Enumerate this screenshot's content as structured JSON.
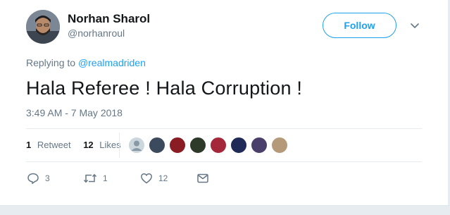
{
  "author": {
    "name": "Norhan Sharol",
    "handle": "@norhanroul"
  },
  "follow_label": "Follow",
  "reply_context": {
    "prefix": "Replying to",
    "mention": "@realmadriden"
  },
  "tweet_text": "Hala Referee ! Hala Corruption !",
  "timestamp": "3:49 AM - 7 May 2018",
  "stats": {
    "retweets_count": "1",
    "retweets_label": "Retweet",
    "likes_count": "12",
    "likes_label": "Likes"
  },
  "liker_avatars": [
    {
      "icon": "default-avatar",
      "color": "#aab8c2"
    },
    {
      "icon": "user-avatar",
      "color": "#3b4a5c"
    },
    {
      "icon": "user-avatar",
      "color": "#8a1c24"
    },
    {
      "icon": "user-avatar",
      "color": "#2d3a2a"
    },
    {
      "icon": "user-avatar",
      "color": "#a4283a"
    },
    {
      "icon": "user-avatar",
      "color": "#1f2a56"
    },
    {
      "icon": "user-avatar",
      "color": "#4a3f6b"
    },
    {
      "icon": "user-avatar",
      "color": "#b59a7a"
    }
  ],
  "actions": {
    "reply_count": "3",
    "retweet_count": "1",
    "like_count": "12"
  },
  "colors": {
    "accent": "#1da1f2",
    "secondary_text": "#657786",
    "divider": "#e6ecf0"
  }
}
